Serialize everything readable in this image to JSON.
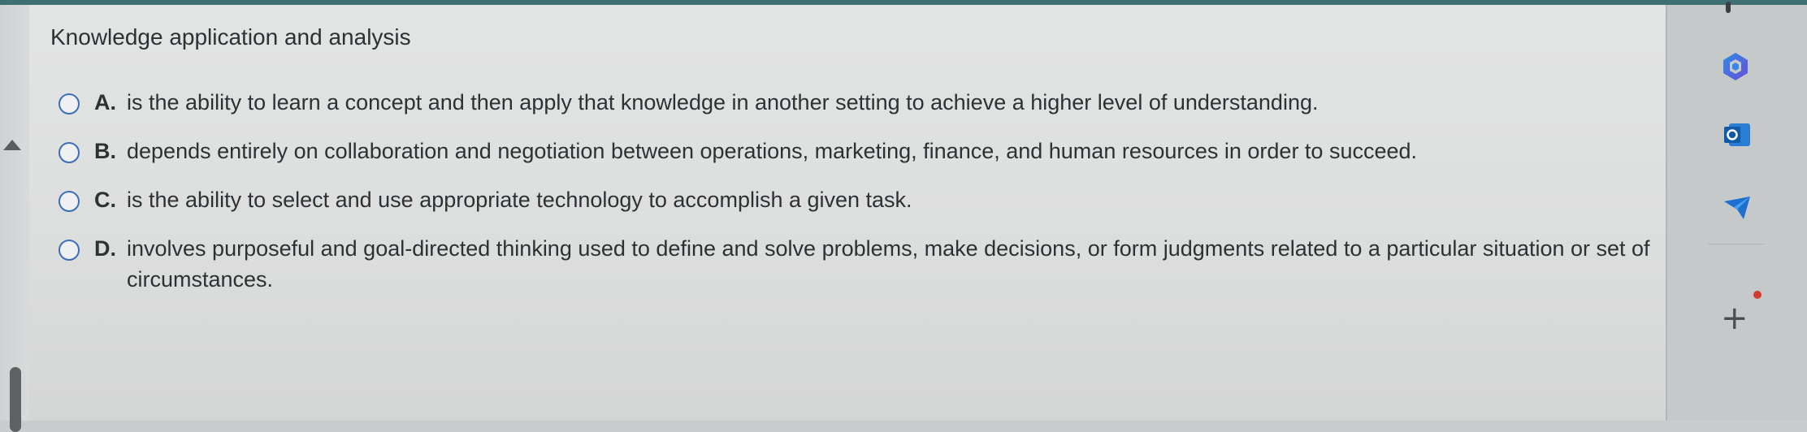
{
  "question": {
    "title": "Knowledge application and analysis"
  },
  "options": [
    {
      "letter": "A.",
      "text": "is the ability to learn a concept and then apply that knowledge in another setting to achieve a higher level of understanding."
    },
    {
      "letter": "B.",
      "text": "depends entirely on collaboration and negotiation between operations, marketing, finance, and human resources in order to succeed."
    },
    {
      "letter": "C.",
      "text": "is the ability to select and use appropriate technology to accomplish a given task."
    },
    {
      "letter": "D.",
      "text": "involves purposeful and goal-directed thinking used to define and solve problems, make decisions, or form judgments related to a particular situation or set of circumstances."
    }
  ],
  "sidebar": {
    "icons": [
      "copilot-icon",
      "outlook-icon",
      "send-icon",
      "add-icon"
    ],
    "add_label": "+"
  },
  "colors": {
    "radio_border": "#3d6fb6",
    "top_strip": "#3f6f73",
    "notification_dot": "#d43a2f"
  }
}
